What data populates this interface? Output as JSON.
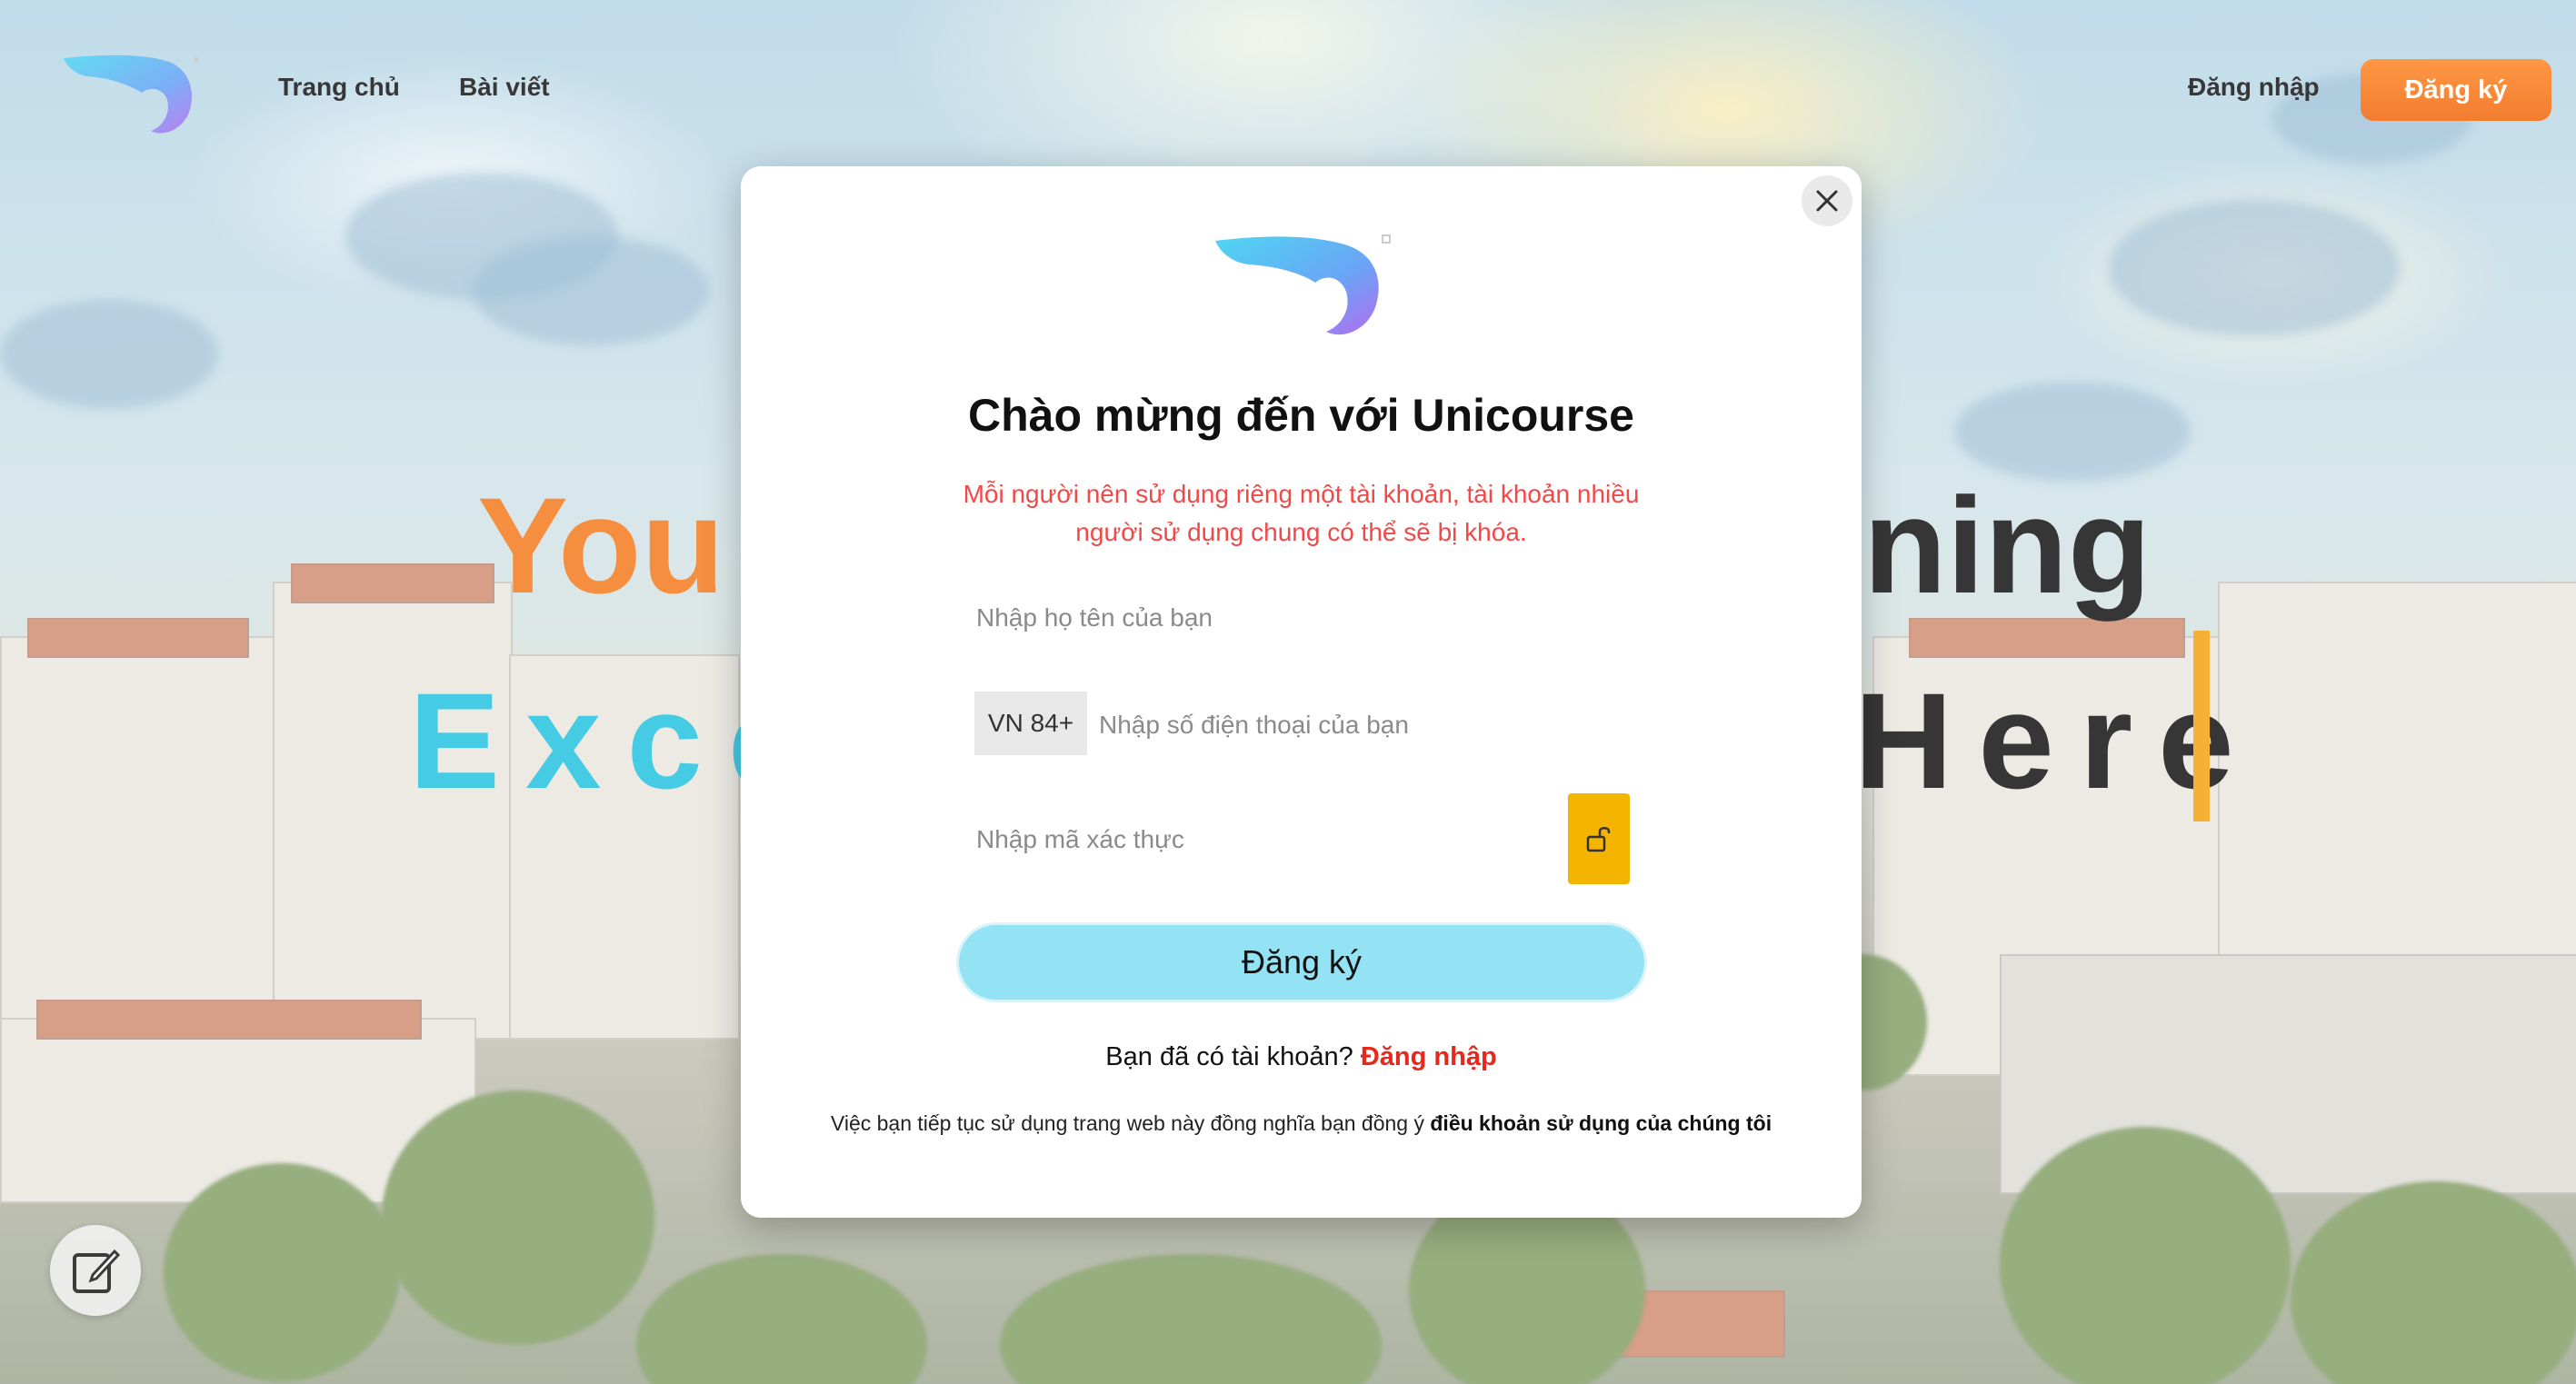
{
  "header": {
    "nav": [
      "Trang chủ",
      "Bài viết"
    ],
    "login_label": "Đăng nhập",
    "signup_label": "Đăng ký"
  },
  "hero": {
    "line1_left": "You",
    "line1_right": "ning",
    "line2_left": "Exce",
    "line2_right": "Here"
  },
  "modal": {
    "title": "Chào mừng đến với Unicourse",
    "note": "Mỗi người nên sử dụng riêng một tài khoản, tài khoản nhiều người sử dụng chung có thể sẽ bị khóa.",
    "name_placeholder": "Nhập họ tên của bạn",
    "phone_prefix": "VN 84+",
    "phone_placeholder": "Nhập số điện thoại của bạn",
    "code_placeholder": "Nhập mã xác thực",
    "submit_label": "Đăng ký",
    "have_account_text": "Bạn đã có tài khoản?",
    "login_link": "Đăng nhập",
    "terms_text": "Việc bạn tiếp tục sử dụng trang web này đồng nghĩa bạn đồng ý",
    "terms_link": "điều khoản sử dụng của chúng tôi"
  },
  "colors": {
    "accent_orange": "#f57f25",
    "signup_button": "#93e3f5",
    "note_red": "#f24848",
    "link_red": "#e8281c",
    "lock_yellow": "#f4b400"
  },
  "icons": [
    "unicorn-logo-icon",
    "close-icon",
    "unlock-icon",
    "edit-note-icon"
  ]
}
